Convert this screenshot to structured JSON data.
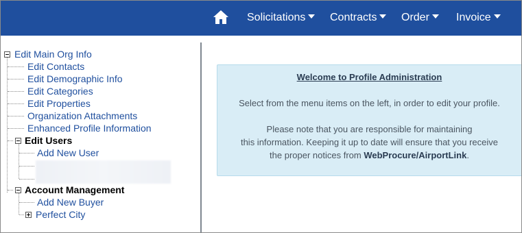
{
  "nav": {
    "items": [
      "Solicitations",
      "Contracts",
      "Order",
      "Invoice"
    ]
  },
  "tree": {
    "root": "Edit Main Org Info",
    "root_children": [
      "Edit Contacts",
      "Edit Demographic Info",
      "Edit Categories",
      "Edit Properties",
      "Organization Attachments",
      "Enhanced Profile Information"
    ],
    "users": "Edit Users",
    "users_children": [
      "Add New User"
    ],
    "account": "Account Management",
    "account_children": [
      "Add New Buyer",
      "Perfect City"
    ]
  },
  "panel": {
    "title": "Welcome to Profile Administration",
    "line1": "Select from the menu items on the left, in order to edit your profile.",
    "line2": "Please note that you are responsible for maintaining",
    "line3": "this information. Keeping it up to date will ensure that you receive",
    "line4_pre": "the proper notices from ",
    "line4_bold": "WebProcure/AirportLink",
    "line4_post": "."
  },
  "colors": {
    "topbar": "#1f4f9e",
    "link": "#1f4f9e",
    "panel_bg": "#d9edf6"
  },
  "icons": [
    "home-icon",
    "caret-down-icon",
    "tree-collapse-icon",
    "tree-expand-icon"
  ]
}
